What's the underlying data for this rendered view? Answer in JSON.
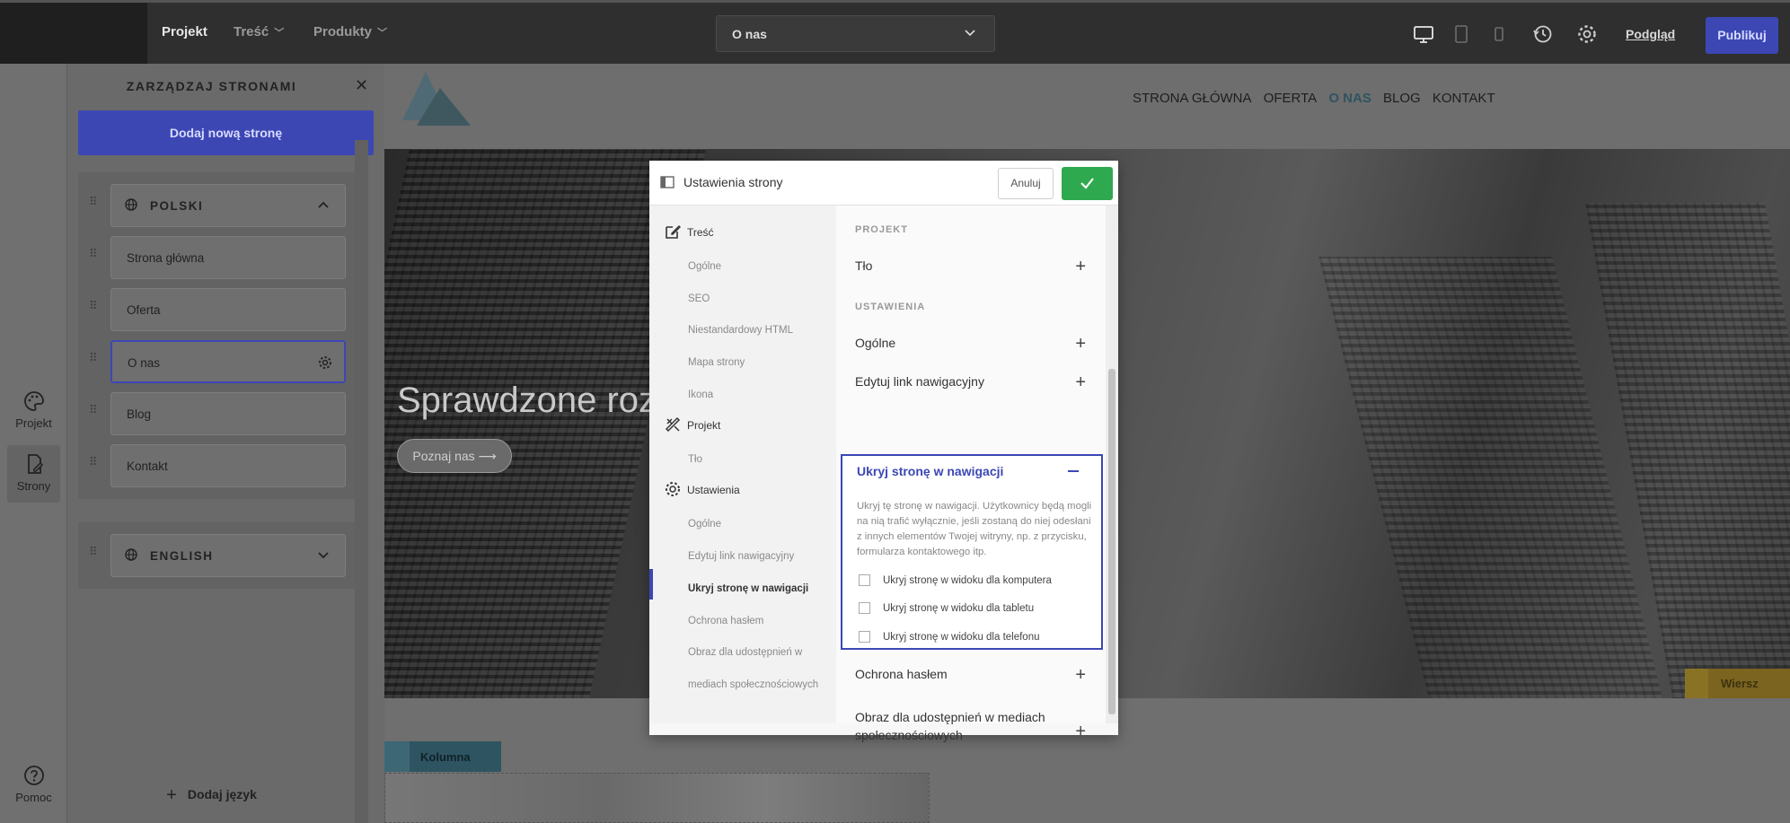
{
  "topbar": {
    "menu": [
      "Projekt",
      "Treść",
      "Produkty"
    ],
    "page_select": "O nas",
    "preview_label": "Podgląd",
    "publish_label": "Publikuj"
  },
  "rail": {
    "items": [
      {
        "label": "Projekt"
      },
      {
        "label": "Strony"
      }
    ],
    "help_label": "Pomoc"
  },
  "pages_panel": {
    "title": "ZARZĄDZAJ STRONAMI",
    "add_page_label": "Dodaj nową stronę",
    "languages": [
      {
        "name": "POLSKI",
        "expanded": true,
        "pages": [
          "Strona główna",
          "Oferta",
          "O nas",
          "Blog",
          "Kontakt"
        ],
        "active_page": "O nas"
      },
      {
        "name": "ENGLISH",
        "expanded": false
      }
    ],
    "add_language_label": "Dodaj język"
  },
  "site": {
    "nav": [
      "STRONA GŁÓWNA",
      "OFERTA",
      "O NAS",
      "BLOG",
      "KONTAKT"
    ],
    "active_nav": "O NAS",
    "hero_title": "Sprawdzone roz",
    "hero_button": "Poznaj nas ⟶",
    "row_tag": "Wiersz",
    "column_tag": "Kolumna"
  },
  "modal": {
    "title": "Ustawienia strony",
    "cancel_label": "Anuluj",
    "nav": {
      "sections": [
        {
          "label": "Treść",
          "items": [
            "Ogólne",
            "SEO",
            "Niestandardowy HTML",
            "Mapa strony",
            "Ikona"
          ]
        },
        {
          "label": "Projekt",
          "items": [
            "Tło"
          ]
        },
        {
          "label": "Ustawienia",
          "items": [
            "Ogólne",
            "Edytuj link nawigacyjny",
            "Ukryj stronę w nawigacji",
            "Ochrona hasłem",
            "Obraz dla udostępnień w",
            "mediach społecznościowych"
          ]
        }
      ],
      "active_item": "Ukryj stronę w nawigacji"
    },
    "body": {
      "project_label": "PROJEKT",
      "background_label": "Tło",
      "settings_label": "USTAWIENIA",
      "general_label": "Ogólne",
      "edit_nav_link_label": "Edytuj link nawigacyjny",
      "hide_section": {
        "title": "Ukryj stronę w nawigacji",
        "description": "Ukryj tę stronę w nawigacji. Użytkownicy będą mogli na nią trafić wyłącznie, jeśli zostaną do niej odesłani z innych elementów Twojej witryny, np. z przycisku, formularza kontaktowego itp.",
        "checkboxes": [
          {
            "label": "Ukryj stronę w widoku dla komputera",
            "checked": false
          },
          {
            "label": "Ukryj stronę w widoku dla tabletu",
            "checked": false
          },
          {
            "label": "Ukryj stronę w widoku dla telefonu",
            "checked": false
          }
        ]
      },
      "password_label": "Ochrona hasłem",
      "social_image_label_1": "Obraz dla udostępnień w mediach",
      "social_image_label_2": "społecznościowych"
    }
  },
  "colors": {
    "accent": "#3c47b4",
    "success": "#2fa94f",
    "topbar": "#2f2f2f"
  }
}
